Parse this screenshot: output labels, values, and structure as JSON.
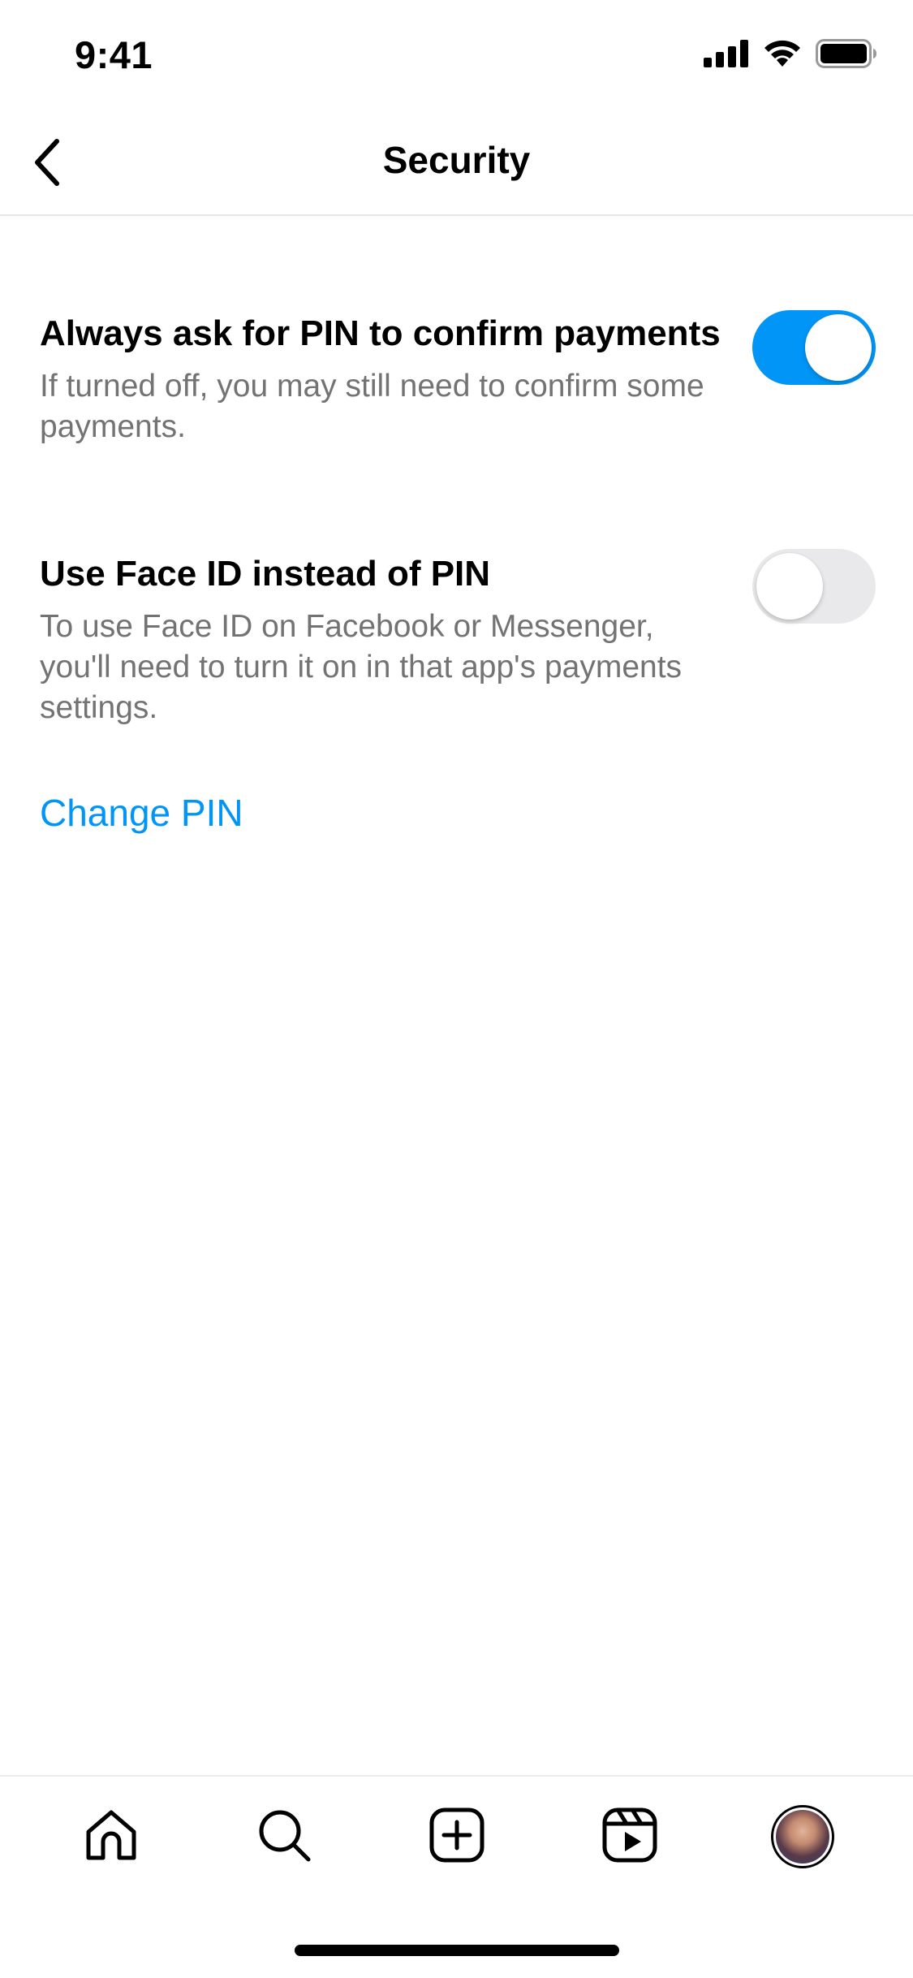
{
  "status_bar": {
    "time": "9:41",
    "icons": [
      "signal-icon",
      "wifi-icon",
      "battery-icon"
    ]
  },
  "header": {
    "title": "Security",
    "back_icon": "chevron-left-icon"
  },
  "settings": [
    {
      "title": "Always ask for PIN to confirm payments",
      "description": "If turned off, you may still need to confirm some payments.",
      "enabled": true
    },
    {
      "title": "Use Face ID instead of PIN",
      "description": "To use Face ID on Facebook or Messenger, you'll need to turn it on in that app's payments settings.",
      "enabled": false
    }
  ],
  "change_pin_label": "Change PIN",
  "tab_bar": {
    "items": [
      "home-icon",
      "search-icon",
      "create-icon",
      "reels-icon",
      "profile-avatar"
    ]
  },
  "colors": {
    "accent": "#0095f6",
    "toggle_off": "#e9e9eb",
    "secondary_text": "#737373",
    "divider": "#e6e6e6"
  }
}
